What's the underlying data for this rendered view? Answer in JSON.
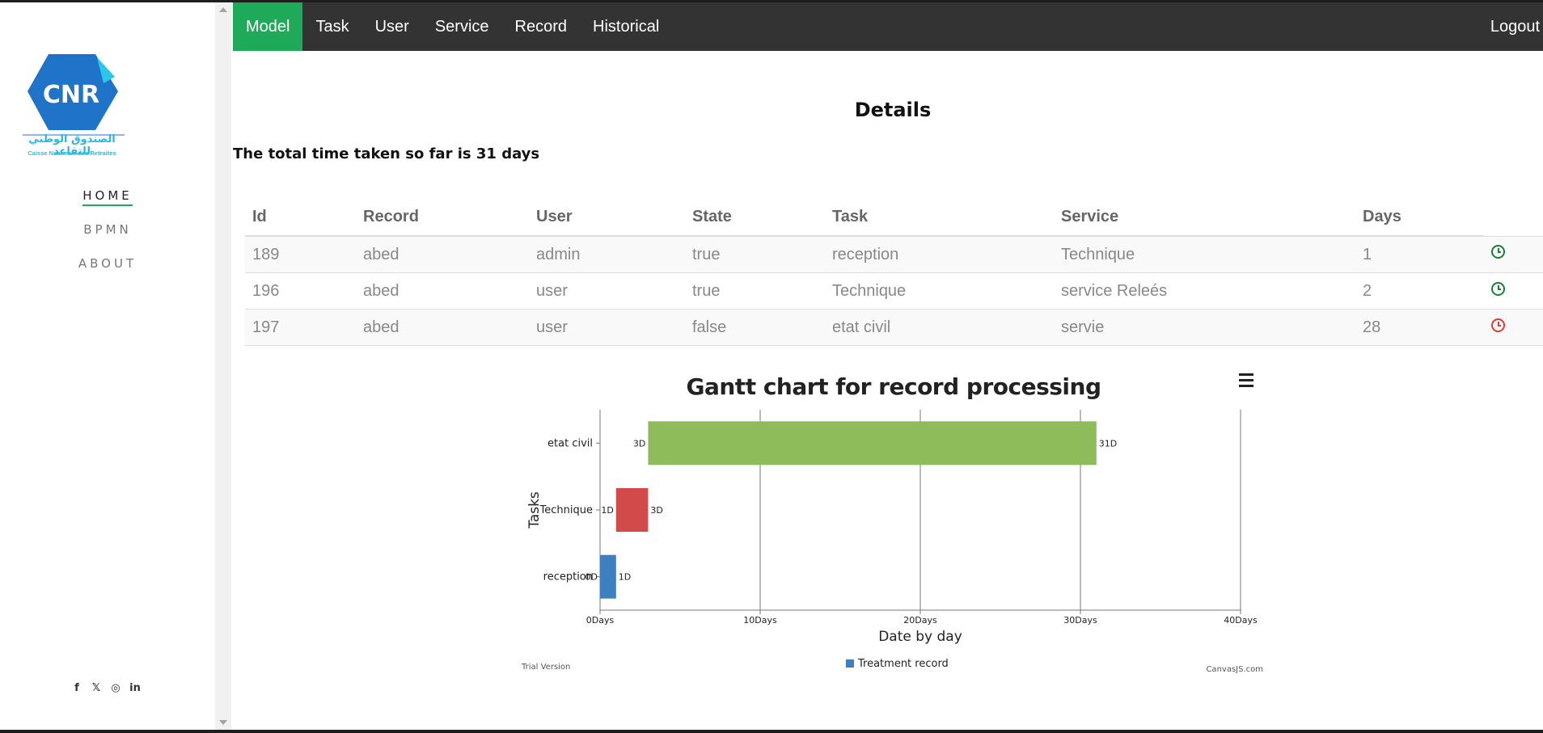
{
  "sidebar": {
    "logo_text": "CNR",
    "logo_arabic": "الصندوق الوطني للتقاعد",
    "logo_subtitle": "Caisse Nationale des Retraites",
    "nav": [
      {
        "label": "HOME"
      },
      {
        "label": "BPMN"
      },
      {
        "label": "ABOUT"
      }
    ],
    "social": [
      "f",
      "𝕏",
      "◎",
      "in"
    ]
  },
  "topbar": {
    "tabs": [
      {
        "label": "Model"
      },
      {
        "label": "Task"
      },
      {
        "label": "User"
      },
      {
        "label": "Service"
      },
      {
        "label": "Record"
      },
      {
        "label": "Historical"
      }
    ],
    "active_tab": "Model",
    "logout_label": "Logout"
  },
  "main": {
    "title": "Details",
    "total_text": "The total time taken so far is 31 days"
  },
  "table": {
    "headers": [
      "Id",
      "Record",
      "User",
      "State",
      "Task",
      "Service",
      "Days"
    ],
    "rows": [
      {
        "id": "189",
        "record": "abed",
        "user": "admin",
        "state": "true",
        "task": "reception",
        "service": "Technique",
        "days": "1",
        "status_color": "#1a7f37"
      },
      {
        "id": "196",
        "record": "abed",
        "user": "user",
        "state": "true",
        "task": "Technique",
        "service": "service Releés",
        "days": "2",
        "status_color": "#1a7f37"
      },
      {
        "id": "197",
        "record": "abed",
        "user": "user",
        "state": "false",
        "task": "etat civil",
        "service": "servie",
        "days": "28",
        "status_color": "#e53935"
      }
    ]
  },
  "chart_data": {
    "type": "bar",
    "orientation": "horizontal-range",
    "title": "Gantt chart for record processing",
    "xlabel": "Date by day",
    "ylabel": "Tasks",
    "xlim": [
      0,
      40
    ],
    "x_ticks": [
      "0Days",
      "10Days",
      "20Days",
      "30Days",
      "40Days"
    ],
    "categories": [
      "etat civil",
      "Technique",
      "reception"
    ],
    "ranges": [
      {
        "task": "etat civil",
        "start": 3,
        "end": 31,
        "start_label": "3D",
        "end_label": "31D",
        "color": "#8fbc5a"
      },
      {
        "task": "Technique",
        "start": 1,
        "end": 3,
        "start_label": "1D",
        "end_label": "3D",
        "color": "#d24a4a"
      },
      {
        "task": "reception",
        "start": 0,
        "end": 1,
        "start_label": "0D",
        "end_label": "1D",
        "color": "#3c80c0"
      }
    ],
    "legend": {
      "label": "Treatment record",
      "color": "#3c80c0",
      "placement": "bottom"
    },
    "footer_left": "Trial Version",
    "footer_right": "CanvasJS.com",
    "grid": true
  }
}
